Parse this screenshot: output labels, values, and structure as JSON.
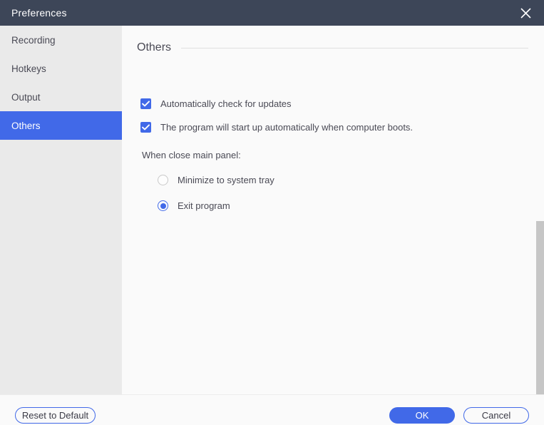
{
  "window": {
    "title": "Preferences",
    "close_icon": "close-icon"
  },
  "theme": {
    "titlebar_bg": "#3d4658",
    "accent": "#4169e8",
    "sidebar_bg": "#eaeaea",
    "content_bg": "#fafafa",
    "text": "#4a4a55",
    "scrollbar_thumb": "#c6c6c6"
  },
  "sidebar": {
    "items": [
      {
        "label": "Recording",
        "active": false
      },
      {
        "label": "Hotkeys",
        "active": false
      },
      {
        "label": "Output",
        "active": false
      },
      {
        "label": "Others",
        "active": true
      }
    ]
  },
  "main": {
    "section_title": "Others",
    "checkboxes": [
      {
        "label": "Automatically check for updates",
        "checked": true,
        "icon": "check-icon"
      },
      {
        "label": "The program will start up automatically when computer boots.",
        "checked": true,
        "icon": "check-icon"
      }
    ],
    "close_panel": {
      "label": "When close main panel:",
      "options": [
        {
          "label": "Minimize to system tray",
          "selected": false
        },
        {
          "label": "Exit program",
          "selected": true
        }
      ]
    }
  },
  "footer": {
    "reset_label": "Reset to Default",
    "ok_label": "OK",
    "cancel_label": "Cancel"
  }
}
